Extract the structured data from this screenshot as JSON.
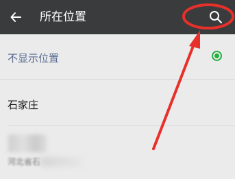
{
  "header": {
    "title": "所在位置",
    "back_icon": "arrow-left-icon",
    "search_icon": "search-icon"
  },
  "list": {
    "hide_location": {
      "label": "不显示位置",
      "selected": true,
      "selected_color": "#24b040"
    },
    "city": {
      "label": "石家庄"
    },
    "blurred_item": {
      "label": "河北省石"
    }
  },
  "colors": {
    "header_bg": "#3a3b3d",
    "annotation": "#e8302a"
  }
}
